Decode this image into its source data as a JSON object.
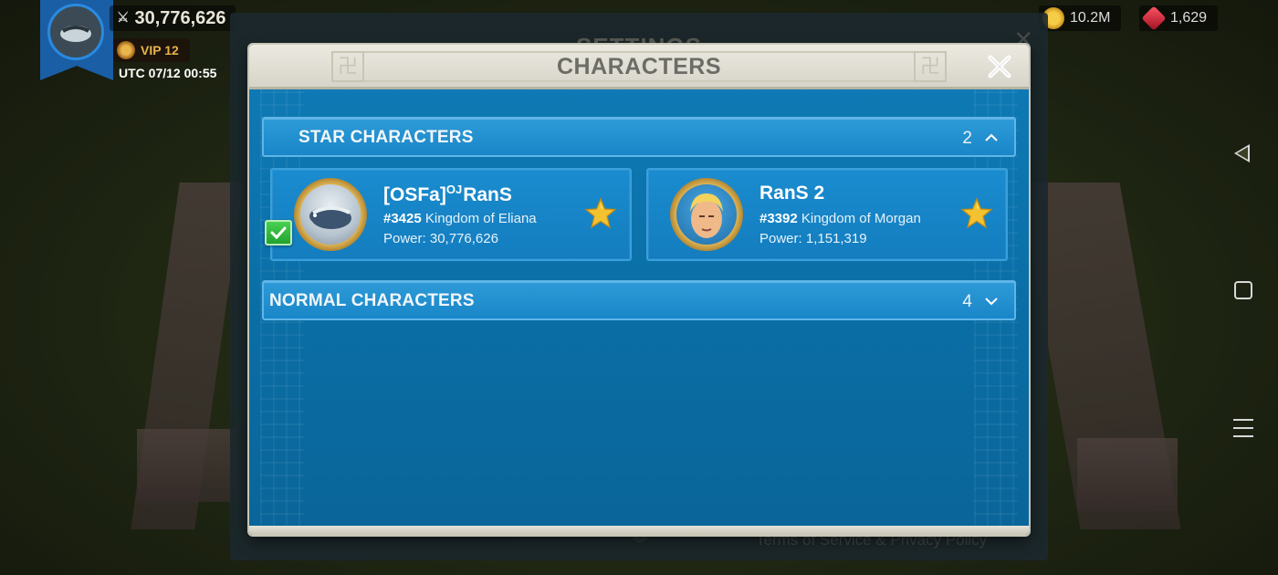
{
  "hud": {
    "power": "30,776,626",
    "vip": "VIP 12",
    "utc": "UTC 07/12 00:55",
    "gold": "10.2M",
    "gems": "1,629"
  },
  "settings": {
    "title": "SETTINGS",
    "footer": "Terms of Service & Privacy Policy"
  },
  "modal": {
    "title": "CHARACTERS",
    "close_icon": "close-icon"
  },
  "star_section": {
    "label": "STAR CHARACTERS",
    "count": "2",
    "expanded": true
  },
  "characters": [
    {
      "name_prefix": "[OSFa]",
      "name_sup": "OJ",
      "name_main": "RanS",
      "kingdom_id": "#3425",
      "kingdom_name": "Kingdom of Eliana",
      "power": "Power: 30,776,626",
      "starred": true,
      "selected": true
    },
    {
      "name_prefix": "",
      "name_sup": "",
      "name_main": "RanS 2",
      "kingdom_id": "#3392",
      "kingdom_name": "Kingdom of Morgan",
      "power": "Power: 1,151,319",
      "starred": true,
      "selected": false
    }
  ],
  "normal_section": {
    "label": "NORMAL CHARACTERS",
    "count": "4",
    "expanded": false
  },
  "colors": {
    "modal_blue": "#0f7bb7",
    "header_blue": "#1986c8",
    "star_gold": "#f2c230",
    "check_green": "#2bb13a"
  }
}
